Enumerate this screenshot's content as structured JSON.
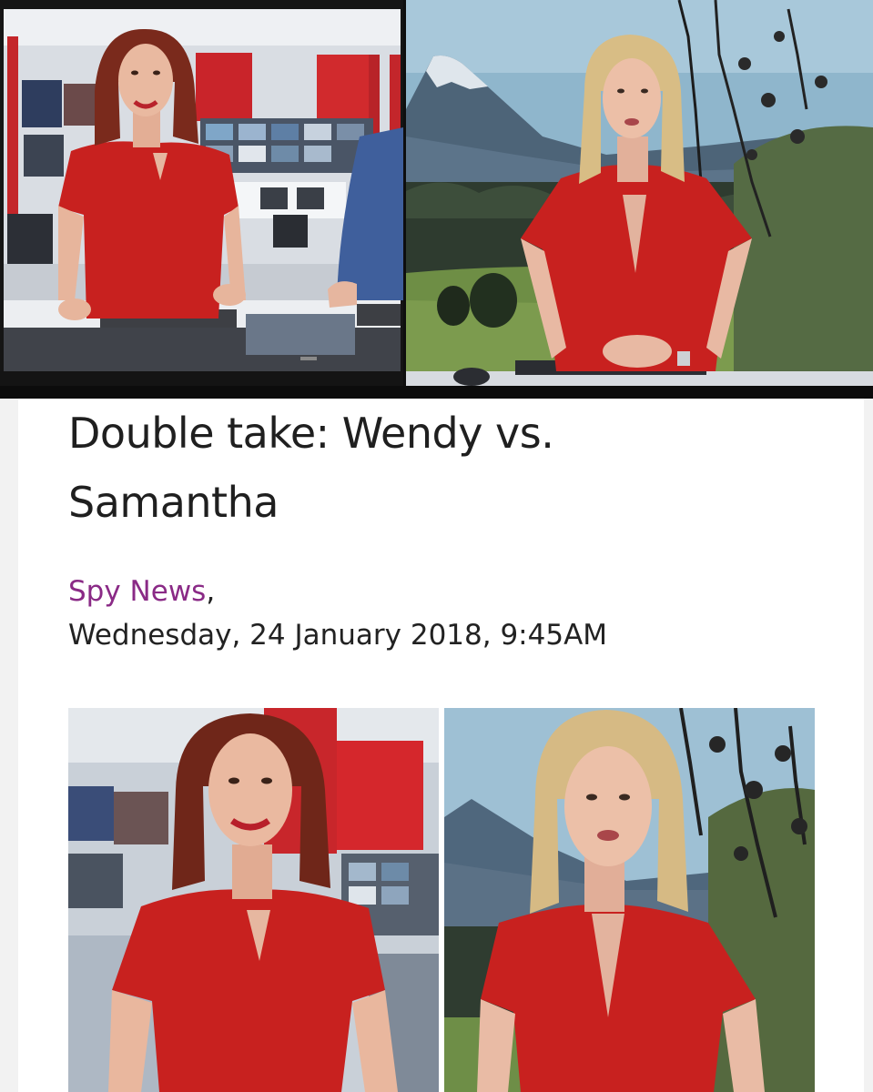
{
  "article": {
    "headline": "Double take: Wendy vs. Samantha",
    "source": "Spy News",
    "source_separator": ",",
    "date": "Wednesday, 24 January 2018, 9:45AM"
  },
  "colors": {
    "source_link": "#8a2a86",
    "dress_red": "#c8211f",
    "headline_text": "#1f1f1f"
  },
  "images": {
    "top_left": "tv-screen-presenter-wendy",
    "top_right": "presenter-samantha-mountain-backdrop",
    "bottom_left": "closeup-wendy-red-dress",
    "bottom_right": "closeup-samantha-red-dress"
  }
}
